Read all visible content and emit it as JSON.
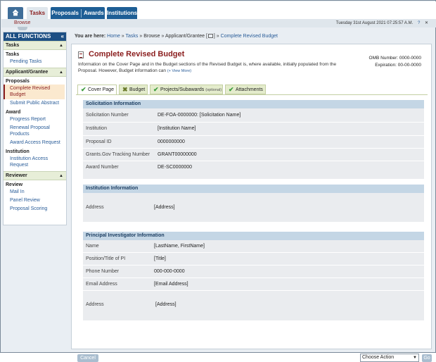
{
  "topnav": {
    "tasks": "Tasks",
    "proposals": "Proposals",
    "awards": "Awards",
    "institutions": "Institutions",
    "browse": "Browse"
  },
  "date": "Tuesday 31st August 2021 07:25:57 A.M.",
  "sidebar": {
    "header": "ALL FUNCTIONS",
    "tasks_section": "Tasks",
    "tasks_group": "Tasks",
    "pending_tasks": "Pending Tasks",
    "applicant_section": "Applicant/Grantee",
    "proposals_group": "Proposals",
    "complete_revised_budget": "Complete Revised Budget",
    "submit_public_abstract": "Submit Public Abstract",
    "award_group": "Award",
    "progress_report": "Progress Report",
    "renewal_proposal_products": "Renewal Proposal Products",
    "award_access_request": "Award Access Request",
    "institution_group": "Institution",
    "institution_access_request": "Institution Access Request",
    "reviewer_section": "Reviewer",
    "review_group": "Review",
    "mail_in": "Mail In",
    "panel_review": "Panel Review",
    "proposal_scoring": "Proposal Scoring"
  },
  "breadcrumb": {
    "prefix": "You are here:",
    "home": "Home",
    "tasks": "Tasks",
    "browse": "Browse",
    "applicant": "Applicant/Grantee [",
    "bracket_close": "]",
    "current": "Complete Revised Budget"
  },
  "page": {
    "title": "Complete Revised Budget",
    "description": "Information on the Cover Page and in the Budget sections of the Revised Budget is, where available, initially populated from the Proposal. However, Budget information can",
    "view_more": "(+ View More)",
    "omb_label": "OMB Number:",
    "omb_value": "0000-0000",
    "exp_label": "Expiration:",
    "exp_value": "00-00-0000"
  },
  "steps": {
    "cover": "Cover Page",
    "budget": "Budget",
    "projects": "Projects/Subawards",
    "projects_opt": "(optional)",
    "attachments": "Attachments"
  },
  "solicitation": {
    "header": "Solicitation Information",
    "rows": [
      {
        "label": "Solicitation Number",
        "value": "DE-FOA-0000000: [Solicitation Name]"
      },
      {
        "label": "Institution",
        "value": "[Institution Name]"
      },
      {
        "label": "Proposal ID",
        "value": "0000000000"
      },
      {
        "label": "Grants.Gov Tracking Number",
        "value": "GRANT00000000"
      },
      {
        "label": "Award Number",
        "value": "DE-SC0000000"
      }
    ]
  },
  "institution": {
    "header": "Institution Information",
    "address_label": "Address",
    "address_value": "[Address]"
  },
  "pi": {
    "header": "Principal Investigator Information",
    "rows": [
      {
        "label": "Name",
        "value": "[LastName, FirstName]"
      },
      {
        "label": "Position/Title of PI",
        "value": "[Title]"
      },
      {
        "label": "Phone Number",
        "value": "000-000-0000"
      },
      {
        "label": "Email Address",
        "value": "[Email Address]"
      },
      {
        "label": "Address",
        "value": "[Address]"
      }
    ]
  },
  "footer": {
    "cancel": "Cancel",
    "choose_action": "Choose Action",
    "go": "Go"
  }
}
